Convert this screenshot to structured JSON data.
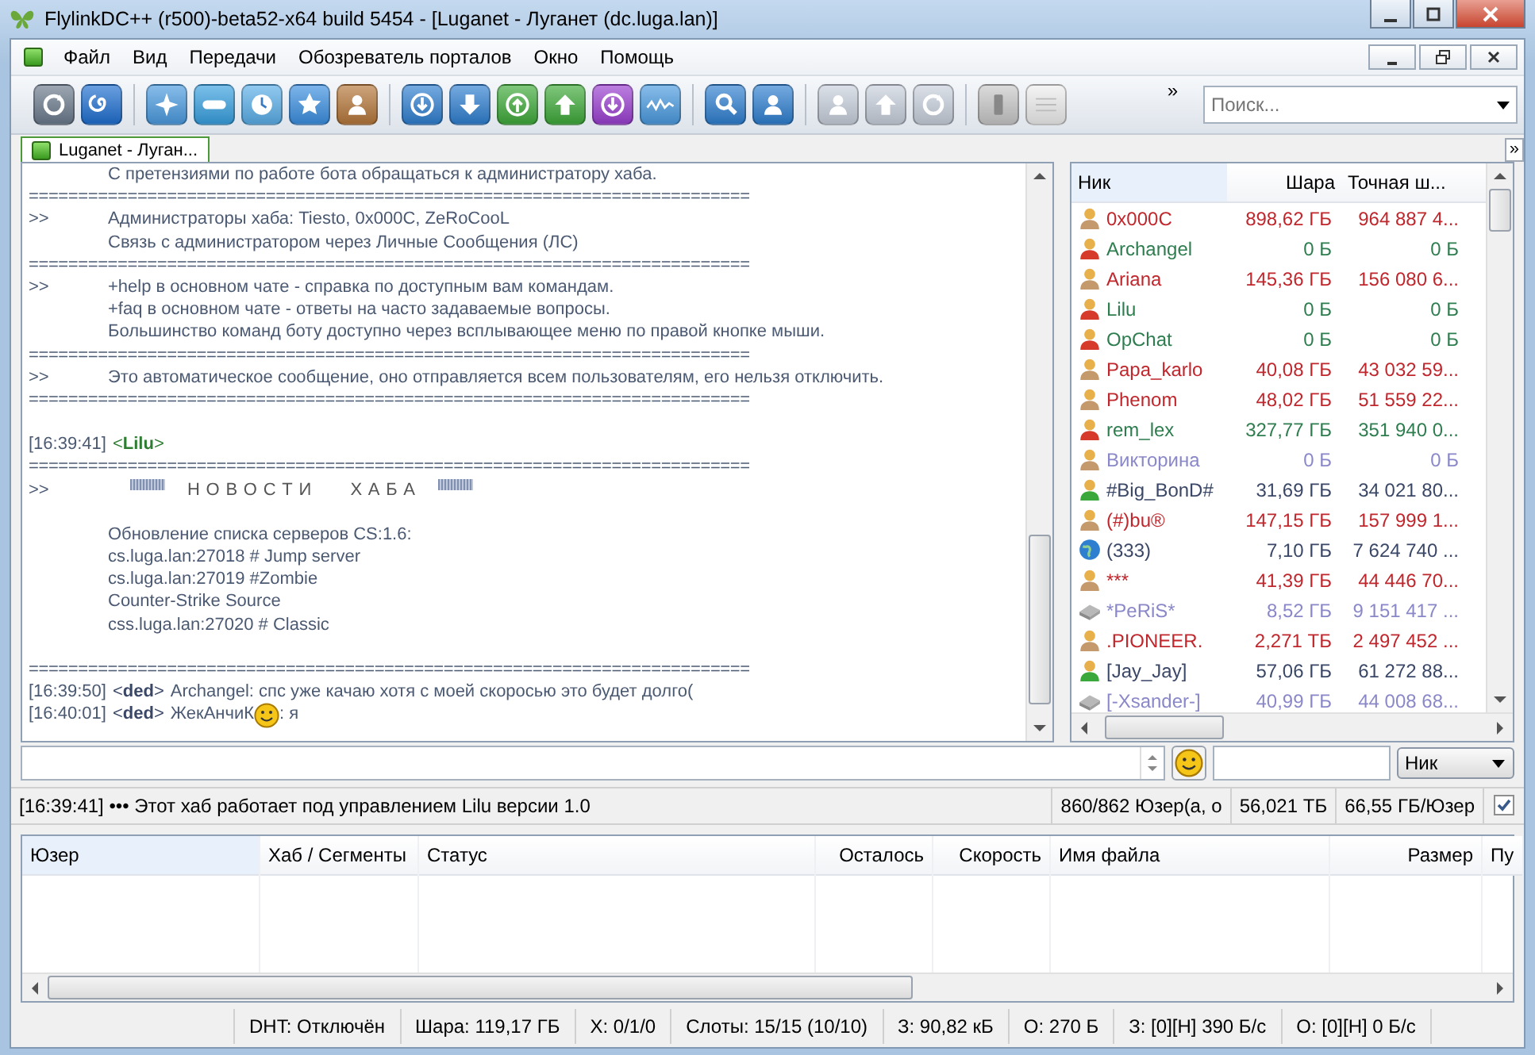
{
  "window": {
    "title": "FlylinkDC++ (r500)-beta52-x64 build 5454 - [Luganet -  Луганет (dc.luga.lan)]"
  },
  "menu": [
    "Файл",
    "Вид",
    "Передачи",
    "Обозреватель порталов",
    "Окно",
    "Помощь"
  ],
  "toolbar": {
    "overflow": "»",
    "search": {
      "placeholder": "Поиск..."
    }
  },
  "tabs": [
    {
      "label": "Luganet -  Луган...",
      "selected": true
    }
  ],
  "tabs_overflow": "»",
  "chat": {
    "lines": [
      {
        "kind": "text",
        "text": "С претензиями по работе бота обращаться к администратору хаба."
      },
      {
        "kind": "sep",
        "text": "========================================================================="
      },
      {
        "kind": "text",
        "prefix": ">>",
        "text": "Администраторы хаба: Tiesto, 0x000C, ZeRoCooL"
      },
      {
        "kind": "text",
        "text": "Связь с администратором через Личные Сообщения (ЛС)"
      },
      {
        "kind": "sep",
        "text": "========================================================================="
      },
      {
        "kind": "text",
        "prefix": ">>",
        "text": "+help в основном чате - справка по доступным вам командам."
      },
      {
        "kind": "text",
        "text": "+faq в основном чате - ответы на часто задаваемые вопросы."
      },
      {
        "kind": "text",
        "text": "Большинство команд боту доступно через всплывающее меню по правой кнопке мыши."
      },
      {
        "kind": "sep",
        "text": "========================================================================="
      },
      {
        "kind": "text",
        "prefix": ">>",
        "text": "Это автоматическое сообщение, оно отправляется всем пользователям, его нельзя отключить."
      },
      {
        "kind": "sep",
        "text": "========================================================================="
      },
      {
        "kind": "blank"
      },
      {
        "kind": "chat",
        "time": "[16:39:41]",
        "nick": "<**Lilu**>",
        "color": "#2e7d32"
      },
      {
        "kind": "sep",
        "text": "========================================================================="
      },
      {
        "kind": "news",
        "prefix": ">>",
        "text": "Н О В О С Т И       Х А Б А"
      },
      {
        "kind": "blank"
      },
      {
        "kind": "text",
        "text": "Обновление списка серверов CS:1.6:"
      },
      {
        "kind": "text",
        "text": "cs.luga.lan:27018 # Jump server"
      },
      {
        "kind": "text",
        "text": "cs.luga.lan:27019 #Zombie"
      },
      {
        "kind": "text",
        "text": "Counter-Strike Source"
      },
      {
        "kind": "text",
        "text": "css.luga.lan:27020 # Classic"
      },
      {
        "kind": "blank"
      },
      {
        "kind": "sep",
        "text": "========================================================================="
      },
      {
        "kind": "chat",
        "time": "[16:39:50]",
        "nick": "<**ded**>",
        "color": "#3a4766",
        "parts": [
          {
            "kind": "text",
            "text": "Archangel: спс уже качаю хотя с моей скоросью это будет долго("
          }
        ]
      },
      {
        "kind": "chat",
        "time": "[16:40:01]",
        "nick": "<**ded**>",
        "color": "#3a4766",
        "parts": [
          {
            "kind": "text",
            "text": "ЖекАнчиК"
          },
          {
            "kind": "smiley"
          },
          {
            "kind": "text",
            "text": ": я"
          }
        ]
      }
    ]
  },
  "users": {
    "columns": [
      "Ник",
      "Шара",
      "Точная ш..."
    ],
    "rows": [
      {
        "nick": "0x000C",
        "share": "898,62 ГБ",
        "exact": "964 887 4...",
        "color": "#c0272d",
        "kind": "user"
      },
      {
        "nick": "Archangel",
        "share": "0 Б",
        "exact": "0 Б",
        "color": "#2e7d4f",
        "kind": "operator"
      },
      {
        "nick": "Ariana",
        "share": "145,36 ГБ",
        "exact": "156 080 6...",
        "color": "#c0272d",
        "kind": "user"
      },
      {
        "nick": "Lilu",
        "share": "0 Б",
        "exact": "0 Б",
        "color": "#2e7d4f",
        "kind": "operator"
      },
      {
        "nick": "OpChat",
        "share": "0 Б",
        "exact": "0 Б",
        "color": "#2e7d4f",
        "kind": "operator"
      },
      {
        "nick": "Papa_karlo",
        "share": "40,08 ГБ",
        "exact": "43 032 59...",
        "color": "#c0272d",
        "kind": "user"
      },
      {
        "nick": "Phenom",
        "share": "48,02 ГБ",
        "exact": "51 559 22...",
        "color": "#c0272d",
        "kind": "user"
      },
      {
        "nick": "rem_lex",
        "share": "327,77 ГБ",
        "exact": "351 940 0...",
        "color": "#2e7d4f",
        "kind": "operator"
      },
      {
        "nick": "Викторина",
        "share": "0 Б",
        "exact": "0 Б",
        "color": "#8a88c8",
        "kind": "user"
      },
      {
        "nick": "#Big_BonD#",
        "share": "31,69 ГБ",
        "exact": "34 021 80...",
        "color": "#3a4766",
        "kind": "active"
      },
      {
        "nick": "(#)bu®",
        "share": "147,15 ГБ",
        "exact": "157 999 1...",
        "color": "#c0272d",
        "kind": "user"
      },
      {
        "nick": "(333)",
        "share": "7,10 ГБ",
        "exact": "7 624 740 ...",
        "color": "#3a4766",
        "kind": "globe"
      },
      {
        "nick": "***",
        "share": "41,39 ГБ",
        "exact": "44 446 70...",
        "color": "#c0272d",
        "kind": "user"
      },
      {
        "nick": "*PeRiS*",
        "share": "8,52 ГБ",
        "exact": "9 151 417 ...",
        "color": "#8a88c8",
        "kind": "passive"
      },
      {
        "nick": ".PIONEER.",
        "share": "2,271 ТБ",
        "exact": "2 497 452 ...",
        "color": "#c0272d",
        "kind": "user"
      },
      {
        "nick": "[Jay_Jay]",
        "share": "57,06 ГБ",
        "exact": "61 272 88...",
        "color": "#3a4766",
        "kind": "active"
      },
      {
        "nick": "[-Xsander-]",
        "share": "40,99 ГБ",
        "exact": "44 008 68...",
        "color": "#8a88c8",
        "kind": "passive"
      }
    ]
  },
  "input": {
    "nick_dropdown": "Ник"
  },
  "hub_status": {
    "message": "[16:39:41] ••• Этот хаб работает под управлением Lilu версии 1.0",
    "users": "860/862 Юзер(а, о",
    "total_share": "56,021 ТБ",
    "per_user": "66,55 ГБ/Юзер",
    "checked": true
  },
  "transfers": {
    "columns": [
      "Юзер",
      "Хаб / Сегменты",
      "Статус",
      "Осталось",
      "Скорость",
      "Имя файла",
      "Размер",
      "Пу"
    ]
  },
  "status_bar": [
    "DHT: Отключён",
    "Шара: 119,17 ГБ",
    "Х: 0/1/0",
    "Слоты: 15/15 (10/10)",
    "З: 90,82 кБ",
    "О: 270 Б",
    "З: [0][Н] 390 Б/с",
    "О: [0][Н] 0 Б/с"
  ]
}
